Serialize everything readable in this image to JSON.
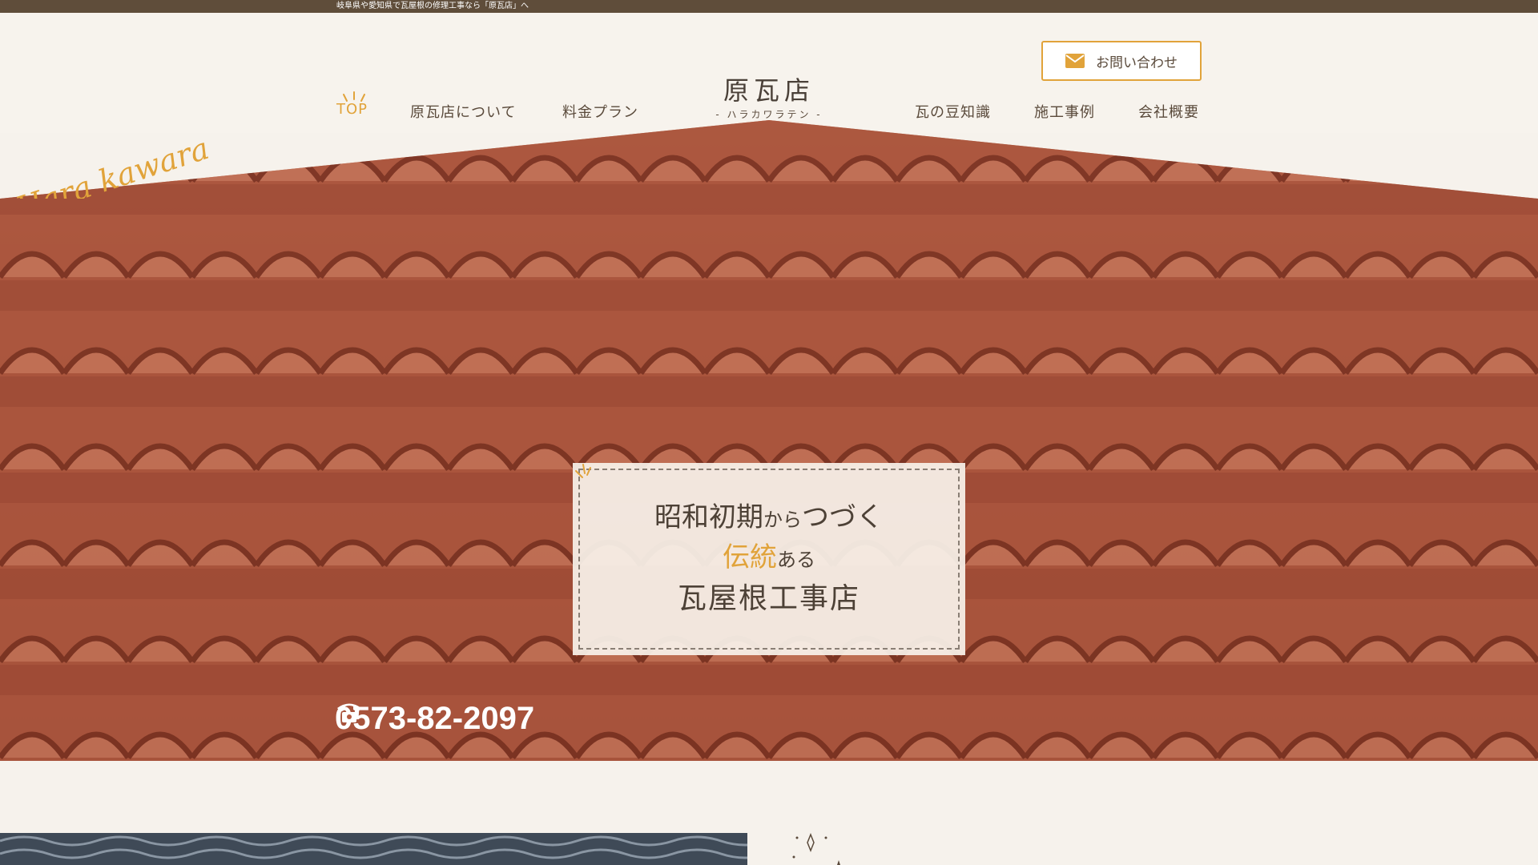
{
  "topbar": {
    "text": "岐阜県や愛知県で瓦屋根の修理工事なら「原瓦店」へ"
  },
  "header": {
    "logo_main": "原瓦店",
    "logo_sub": "- ハラカワラテン -",
    "contact_label": "お問い合わせ",
    "nav_left": [
      {
        "label": "TOP",
        "active": true
      },
      {
        "label": "原瓦店について",
        "active": false
      },
      {
        "label": "料金プラン",
        "active": false
      }
    ],
    "nav_right": [
      {
        "label": "瓦の豆知識",
        "active": false
      },
      {
        "label": "施工事例",
        "active": false
      },
      {
        "label": "会社概要",
        "active": false
      }
    ]
  },
  "hero": {
    "line1_main": "昭和初期",
    "line1_small": "から",
    "line1_end": "つづく",
    "line2_accent": "伝統",
    "line2_small": "ある",
    "line3": "瓦屋根工事店",
    "script": "Hara kawara",
    "phone": "0573-82-2097"
  },
  "colors": {
    "accent": "#e1a33a",
    "brown_bar": "#5f4d3a",
    "tile": "#b85f45",
    "background": "#f6f2ec"
  },
  "icons": {
    "mail": "mail-icon",
    "phone": "phone-icon",
    "sparkle": "sparkle-icon"
  }
}
